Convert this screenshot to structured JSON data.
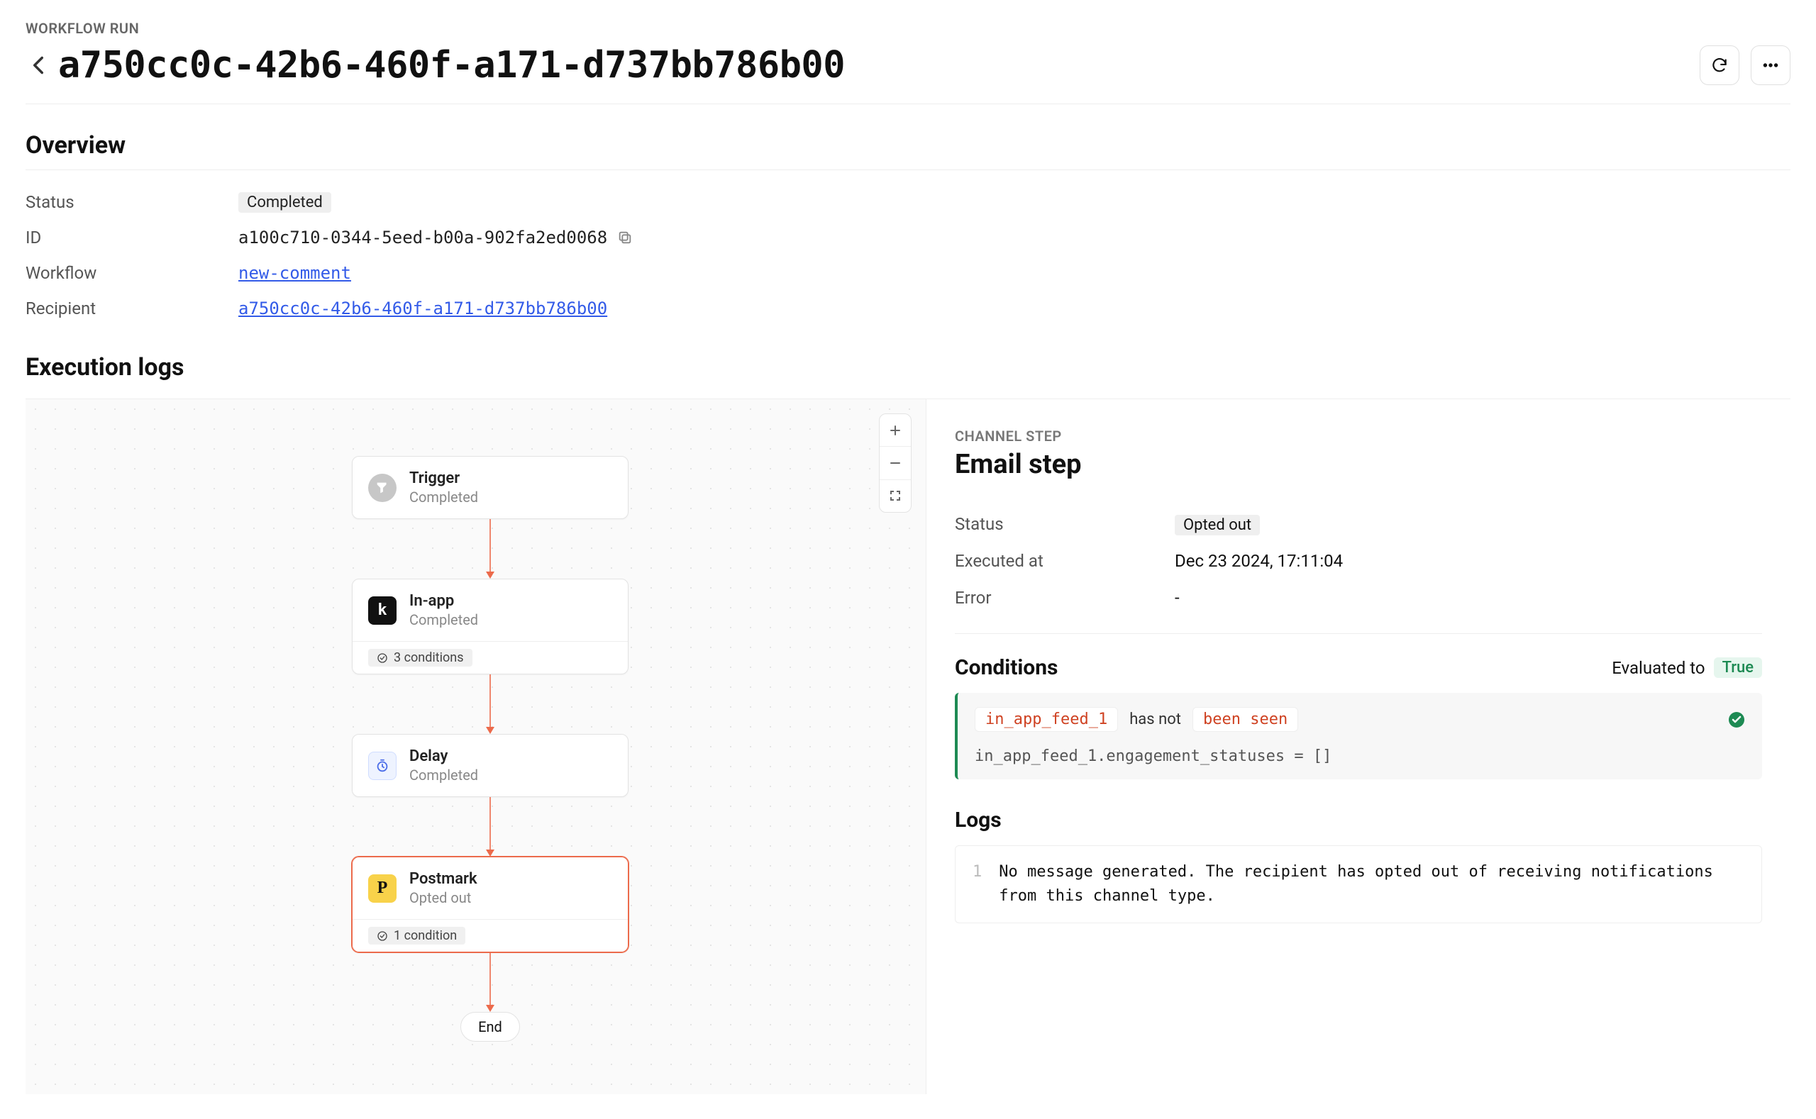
{
  "header": {
    "eyebrow": "WORKFLOW RUN",
    "title": "a750cc0c-42b6-460f-a171-d737bb786b00"
  },
  "overview": {
    "title": "Overview",
    "status_label": "Status",
    "status_value": "Completed",
    "id_label": "ID",
    "id_value": "a100c710-0344-5eed-b00a-902fa2ed0068",
    "workflow_label": "Workflow",
    "workflow_value": "new-comment",
    "recipient_label": "Recipient",
    "recipient_value": "a750cc0c-42b6-460f-a171-d737bb786b00"
  },
  "exec_title": "Execution logs",
  "nodes": {
    "trigger": {
      "title": "Trigger",
      "sub": "Completed"
    },
    "inapp": {
      "title": "In-app",
      "sub": "Completed",
      "chip": "3 conditions",
      "icon_glyph": "k"
    },
    "delay": {
      "title": "Delay",
      "sub": "Completed"
    },
    "postmark": {
      "title": "Postmark",
      "sub": "Opted out",
      "chip": "1 condition",
      "icon_glyph": "P"
    },
    "end": "End"
  },
  "detail": {
    "eyebrow": "CHANNEL STEP",
    "title": "Email step",
    "status_label": "Status",
    "status_value": "Opted out",
    "executed_label": "Executed at",
    "executed_value": "Dec 23 2024, 17:11:04",
    "error_label": "Error",
    "error_value": "-",
    "conditions_title": "Conditions",
    "evaluated_to_label": "Evaluated to",
    "evaluated_to_value": "True",
    "cond_chip1": "in_app_feed_1",
    "cond_text": "has not",
    "cond_chip2": "been seen",
    "cond_sub": "in_app_feed_1.engagement_statuses = []",
    "logs_title": "Logs",
    "log_num": "1",
    "log_text": "No message generated. The recipient has opted out of receiving notifications from this channel type."
  }
}
